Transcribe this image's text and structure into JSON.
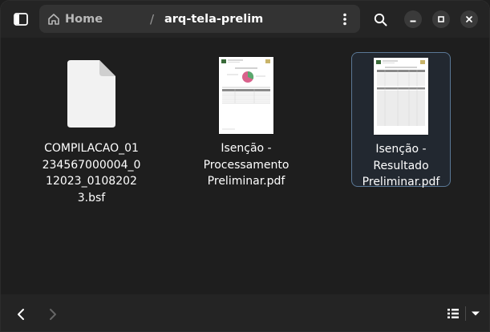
{
  "header": {
    "breadcrumb": {
      "home_label": "Home",
      "separator": "/",
      "current": "arq-tela-prelim"
    }
  },
  "files": [
    {
      "name": "COMPILACAO_01234567000004_012023_01082023.bsf",
      "icon": "generic-document-icon",
      "selected": false
    },
    {
      "name": "Isenção - Processamento Preliminar.pdf",
      "icon": "pdf-thumbnail-pie-chart",
      "selected": false
    },
    {
      "name": "Isenção - Resultado Preliminar.pdf",
      "icon": "pdf-thumbnail-table",
      "selected": true
    }
  ],
  "colors": {
    "window_bg": "#1e1e1e",
    "headerbar_bg": "#242424",
    "pathbar_bg": "#333333",
    "selection_border": "#5a7896",
    "pie_pink": "#d9628c",
    "pie_green": "#5aa86e"
  },
  "icons": {
    "sidebar_toggle": "sidebar-show-icon",
    "home": "home-icon",
    "path_menu": "view-more-icon",
    "search": "search-icon",
    "minimize": "window-minimize-icon",
    "maximize": "window-maximize-icon",
    "close": "window-close-icon",
    "back": "go-back-icon",
    "forward": "go-forward-icon",
    "view_list": "view-list-icon",
    "view_menu": "pan-down-icon"
  }
}
